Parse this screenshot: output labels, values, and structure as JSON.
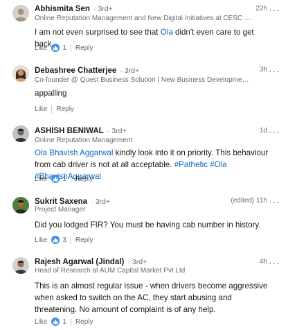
{
  "colors": {
    "link": "#0a66c2",
    "like_badge": "#378fe9"
  },
  "comments": [
    {
      "name": "Abhismita Sen",
      "degree": "· 3rd+",
      "headline": "Online Reputation Management and New Digital Initiatives at CESC Limited",
      "time": "22h",
      "body": [
        "I am not even surprised to see that ",
        "Ola",
        " didn't even care to get back"
      ],
      "like_label": "Like",
      "reaction_count": "1",
      "reply_label": "Reply",
      "avatar": "default-person"
    },
    {
      "name": "Debashree Chatterjee",
      "degree": "· 3rd+",
      "headline": "Co-founder @ Quest Business Solution | New Business Development | Fractio...",
      "time": "3h",
      "body": [
        "appalling"
      ],
      "like_label": "Like",
      "reply_label": "Reply",
      "avatar": "photo-woman"
    },
    {
      "name": "ASHISH BENIWAL",
      "degree": "· 3rd+",
      "headline": "Online Reputation Management",
      "time": "1d",
      "body": [
        "Ola Bhavish Aggarwal",
        " kindly look into it on priority. This behaviour from cab driver is not at all acceptable. ",
        "#Pathetic #Ola #BhavishAggarwal"
      ],
      "like_label": "Like",
      "reaction_count": "1",
      "reply_label": "Reply",
      "avatar": "photo-man"
    },
    {
      "name": "Sukrit Saxena",
      "degree": "· 3rd+",
      "headline": "Project Manager",
      "time": "(edited) 11h",
      "body": [
        "Did you lodged FIR? You must be having cab number in history."
      ],
      "like_label": "Like",
      "reaction_count": "3",
      "reply_label": "Reply",
      "avatar": "photo-man-green"
    },
    {
      "name": "Rajesh Agarwal (Jindal)",
      "degree": "· 3rd+",
      "headline": "Head of Research at AUM Capital Market Pvt Ltd",
      "time": "4h",
      "body": [
        "This is an almost regular issue - when drivers become aggressive when asked to switch on the AC, they start abusing and threatening. No amount of complaint is of any help."
      ],
      "like_label": "Like",
      "reaction_count": "1",
      "reply_label": "Reply",
      "avatar": "photo-man-dark"
    }
  ]
}
